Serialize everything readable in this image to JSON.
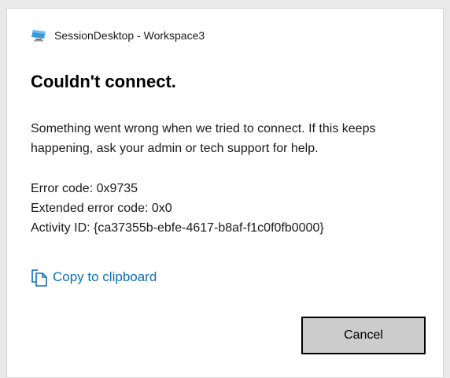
{
  "window": {
    "title": "SessionDesktop - Workspace3",
    "icon": "monitor-icon"
  },
  "dialog": {
    "heading": "Couldn't connect.",
    "message": "Something went wrong when we tried to connect. If this keeps happening, ask your admin or tech support for help.",
    "details": {
      "error_code": "Error code: 0x9735",
      "extended_error_code": "Extended error code: 0x0",
      "activity_id": "Activity ID: {ca37355b-ebfe-4617-b8af-f1c0f0fb0000}"
    },
    "copy_link": {
      "label": "Copy to clipboard",
      "icon": "copy-icon"
    },
    "cancel_label": "Cancel"
  },
  "colors": {
    "link": "#0e6fb8",
    "button_bg": "#cccccc",
    "button_border": "#000000",
    "dialog_bg": "#ffffff"
  }
}
